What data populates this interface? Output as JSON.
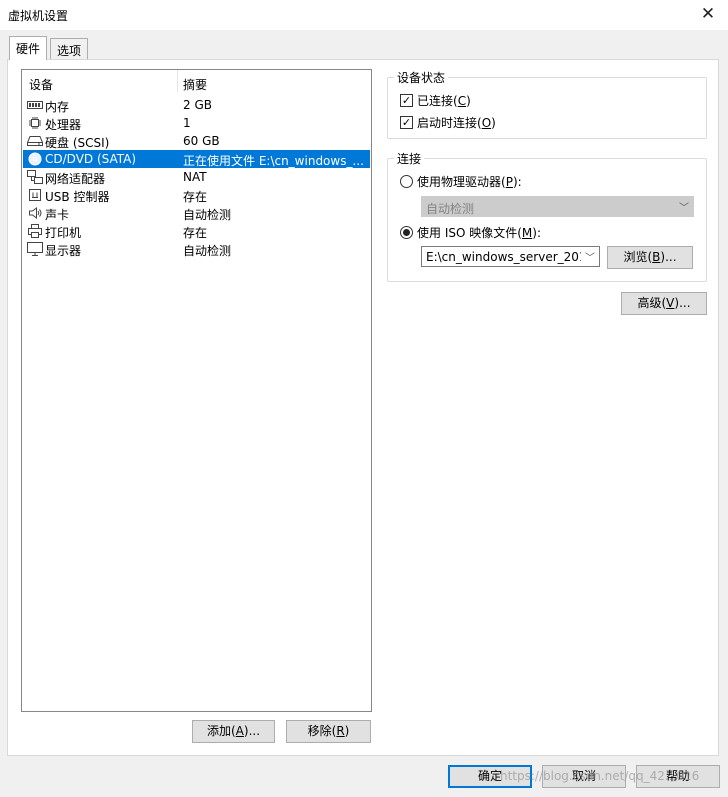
{
  "window": {
    "title": "虚拟机设置",
    "close_glyph": "✕"
  },
  "tabs": [
    {
      "label": "硬件",
      "active": true
    },
    {
      "label": "选项",
      "active": false
    }
  ],
  "device_list": {
    "columns": [
      "设备",
      "摘要"
    ],
    "rows": [
      {
        "icon": "memory-icon",
        "name": "内存",
        "summary": "2 GB",
        "selected": false
      },
      {
        "icon": "processor-icon",
        "name": "处理器",
        "summary": "1",
        "selected": false
      },
      {
        "icon": "hard-disk-icon",
        "name": "硬盘 (SCSI)",
        "summary": "60 GB",
        "selected": false
      },
      {
        "icon": "cd-dvd-icon",
        "name": "CD/DVD (SATA)",
        "summary": "正在使用文件 E:\\cn_windows_...",
        "selected": true
      },
      {
        "icon": "network-adapter-icon",
        "name": "网络适配器",
        "summary": "NAT",
        "selected": false
      },
      {
        "icon": "usb-controller-icon",
        "name": "USB 控制器",
        "summary": "存在",
        "selected": false
      },
      {
        "icon": "sound-card-icon",
        "name": "声卡",
        "summary": "自动检测",
        "selected": false
      },
      {
        "icon": "printer-icon",
        "name": "打印机",
        "summary": "存在",
        "selected": false
      },
      {
        "icon": "display-icon",
        "name": "显示器",
        "summary": "自动检测",
        "selected": false
      }
    ]
  },
  "buttons": {
    "add": {
      "text": "添加(",
      "key": "A",
      "suffix": ")..."
    },
    "remove": {
      "text": "移除(",
      "key": "R",
      "suffix": ")"
    },
    "browse": {
      "text": "浏览(",
      "key": "B",
      "suffix": ")..."
    },
    "advanced": {
      "text": "高级(",
      "key": "V",
      "suffix": ")..."
    },
    "ok": "确定",
    "cancel": "取消",
    "help": "帮助"
  },
  "device_status": {
    "legend": "设备状态",
    "connected": {
      "text": "已连接(",
      "key": "C",
      "suffix": ")",
      "checked": true
    },
    "connect_at_power_on": {
      "text": "启动时连接(",
      "key": "O",
      "suffix": ")",
      "checked": true
    }
  },
  "connection": {
    "legend": "连接",
    "physical_drive": {
      "text": "使用物理驱动器(",
      "key": "P",
      "suffix": "):",
      "selected": false
    },
    "physical_drive_combo": {
      "value": "自动检测",
      "enabled": false
    },
    "iso_image": {
      "text": "使用 ISO 映像文件(",
      "key": "M",
      "suffix": "):",
      "selected": true
    },
    "iso_path": "E:\\cn_windows_server_201"
  },
  "watermark": "https://blog.csdn.net/qq_42...016",
  "colors": {
    "selection": "#0078d7",
    "button_face": "#e1e1e1",
    "window_bg": "#f0f0f0"
  }
}
